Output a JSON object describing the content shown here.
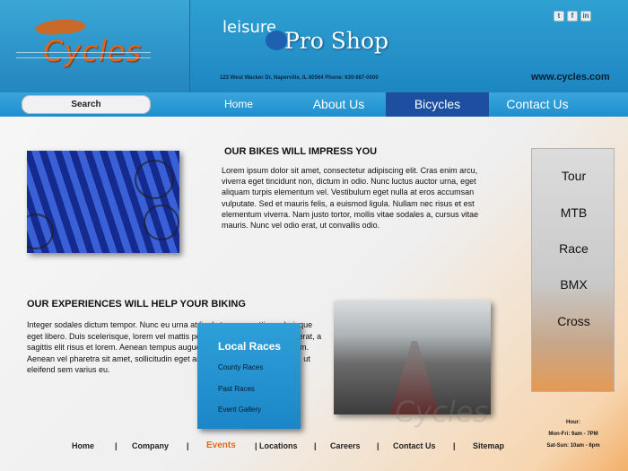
{
  "header": {
    "logo_text": "Cycles",
    "shop_prefix": "leisure",
    "shop_name": "Pro Shop",
    "address": "123 West Wacker Dr, Naperville, IL 60564  Phone: 630-987-0000",
    "website": "www.cycles.com",
    "social": [
      "t",
      "f",
      "in"
    ]
  },
  "search": {
    "label": "Search"
  },
  "nav": {
    "home": "Home",
    "about": "About Us",
    "bicycles": "Bicycles",
    "contact": "Contact Us"
  },
  "section1": {
    "title": "OUR BIKES WILL IMPRESS YOU",
    "body": "Lorem ipsum dolor sit amet, consectetur adipiscing elit. Cras enim arcu, viverra eget tincidunt non, dictum in odio. Nunc luctus auctor urna, eget aliquam turpis elementum vel. Vestibulum eget nulla at eros accumsan vulputate. Sed et mauris felis, a euismod ligula. Nullam nec risus et est elementum viverra. Nam justo tortor, mollis vitae sodales a, cursus vitae mauris. Nunc vel odio erat, ut convallis odio."
  },
  "section2": {
    "title": "OUR EXPERIENCES WILL HELP YOUR BIKING",
    "body": "Integer sodales dictum tempor. Nunc eu urna at ligula tempor mattis scelerisque eget libero. Duis scelerisque, lorem vel mattis posuere, quam leo commodo erat, a sagittis elit risus et lorem. Aenean tempus augue in nulla ullamcorper interdum. Aenean vel pharetra sit amet, sollicitudin eget ante. Sed vitae magna sapien, ut eleifend sem varius eu."
  },
  "dropdown": {
    "heading": "Local Races",
    "items": [
      "County Races",
      "Past Races",
      "Event Gallery"
    ]
  },
  "sidemenu": [
    "Tour",
    "MTB",
    "Race",
    "BMX",
    "Cross"
  ],
  "hours": {
    "title": "Hour:",
    "weekday": "Mon-Fri: 9am - 7PM",
    "weekend": "Sat-Sun: 10am - 6pm"
  },
  "watermark": "Cycles",
  "footer": {
    "items": [
      "Home",
      "Company",
      "Events",
      "Locations",
      "Careers",
      "Contact Us",
      "Sitemap"
    ]
  },
  "colors": {
    "header_blue": "#1d86c1",
    "nav_active": "#1c4fa0",
    "accent_orange": "#e36a1c"
  }
}
